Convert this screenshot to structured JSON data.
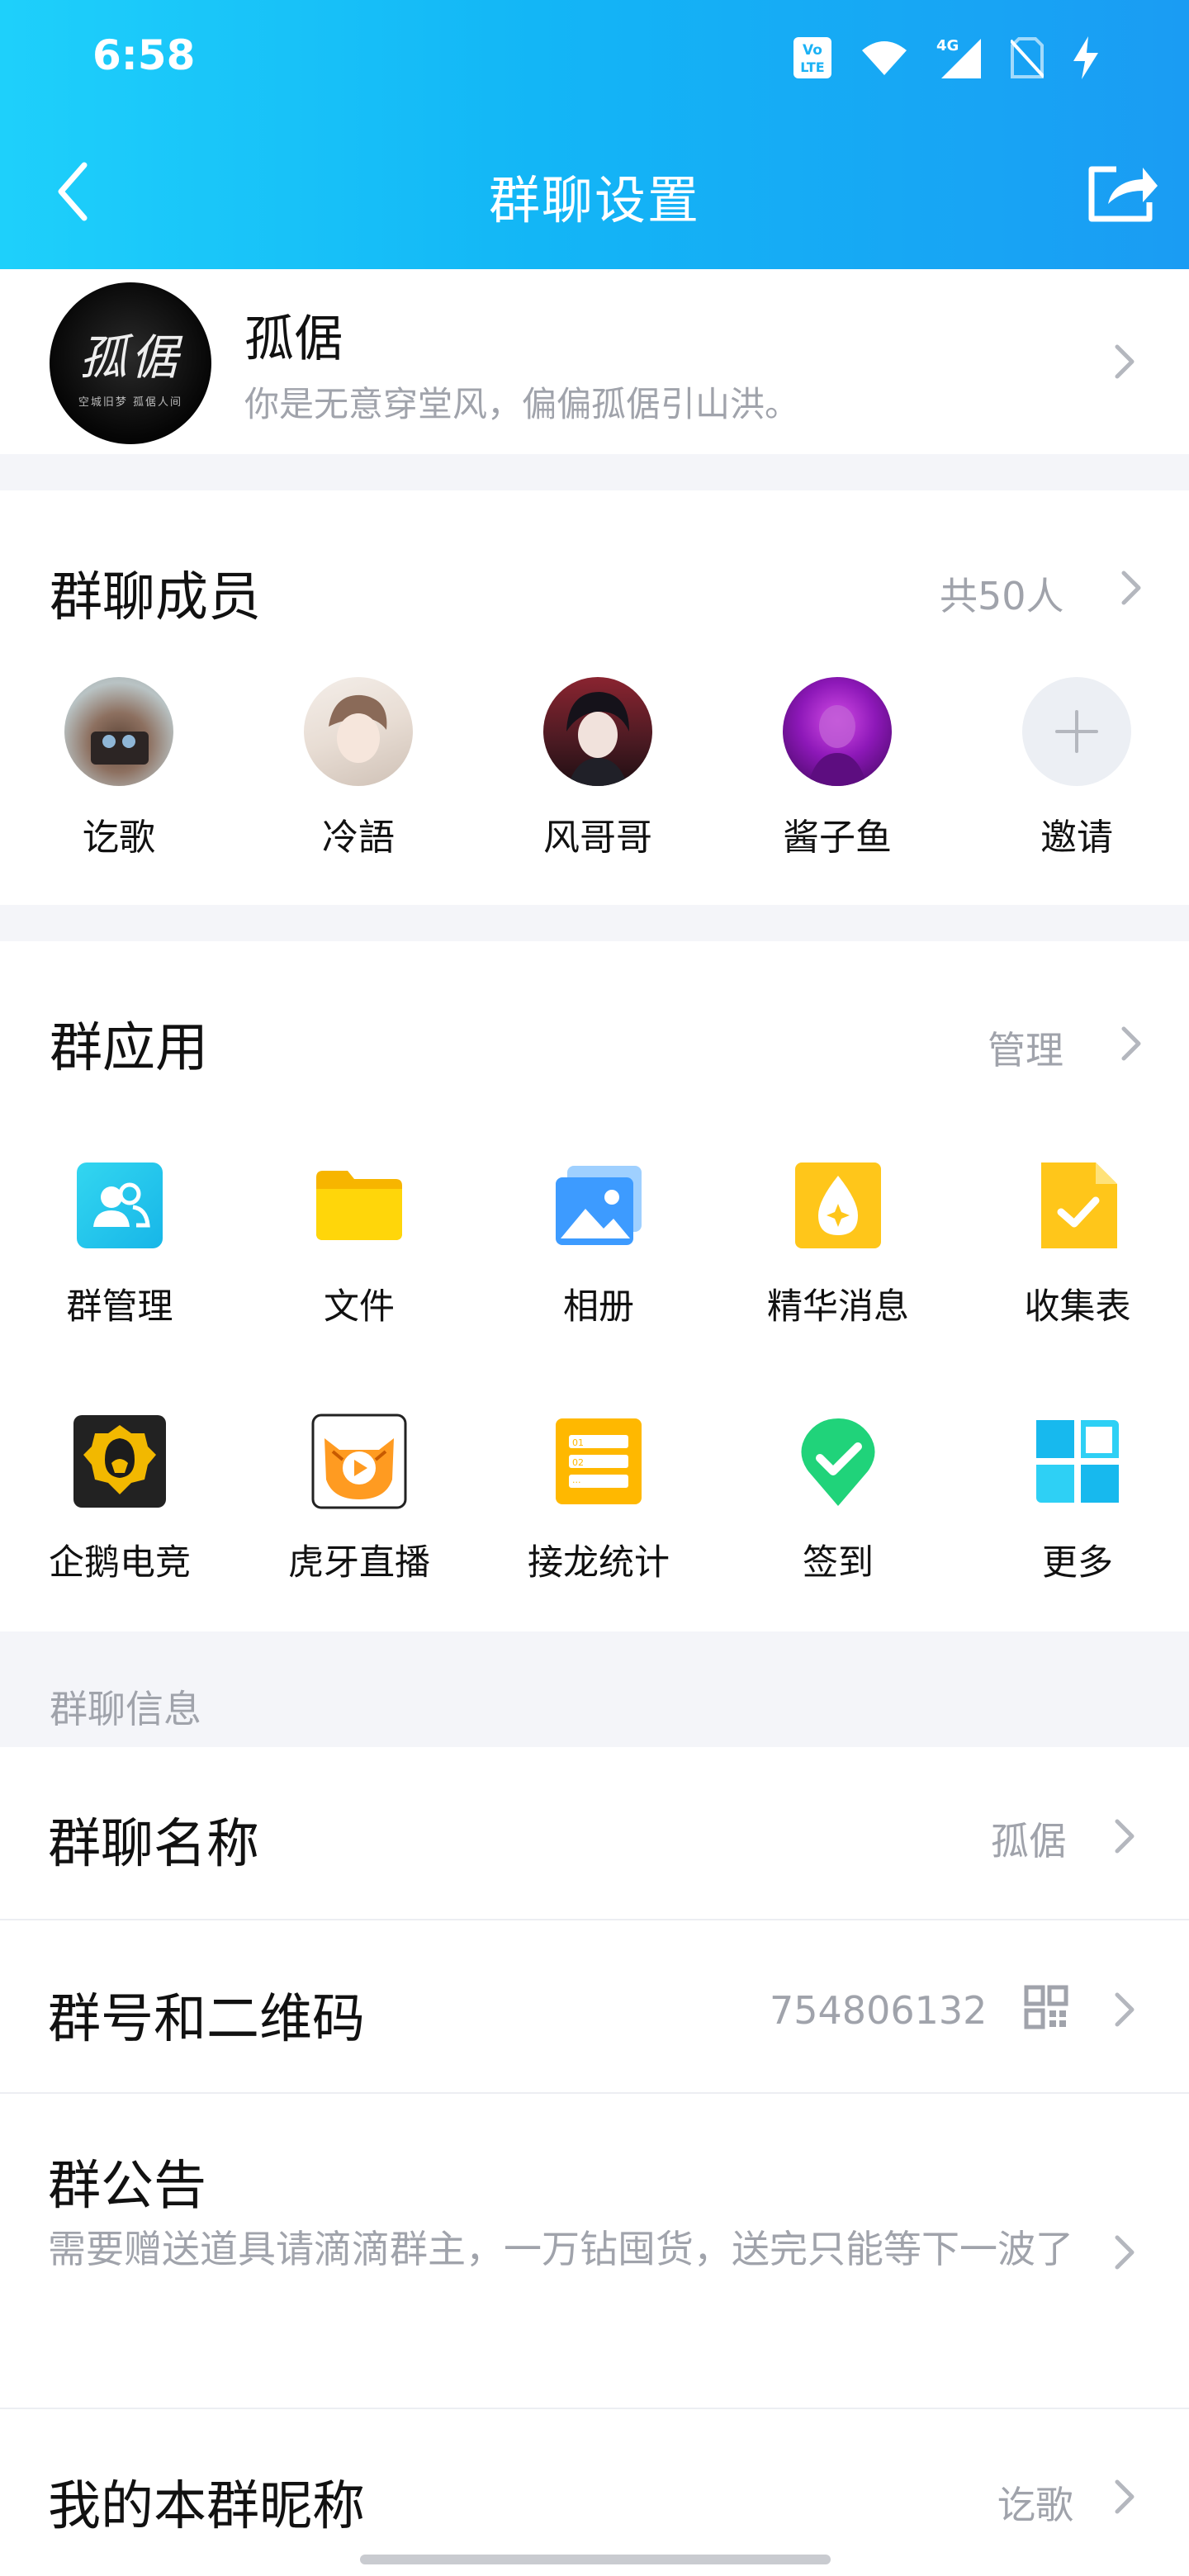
{
  "status_bar": {
    "time": "6:58",
    "volte": "Vo LTE",
    "network": "4G"
  },
  "nav": {
    "title": "群聊设置"
  },
  "group": {
    "name": "孤倨",
    "description": "你是无意穿堂风，偏偏孤倨引山洪。",
    "avatar_text": "孤倨",
    "avatar_subtext": "空城旧梦 孤倨人间"
  },
  "members": {
    "title": "群聊成员",
    "count": "共50人",
    "list": [
      {
        "name": "讫歌"
      },
      {
        "name": "冷語"
      },
      {
        "name": "风哥哥"
      },
      {
        "name": "酱子鱼"
      },
      {
        "name": "邀请"
      }
    ]
  },
  "apps": {
    "title": "群应用",
    "manage": "管理",
    "items": [
      {
        "label": "群管理",
        "icon": "group-manage-icon"
      },
      {
        "label": "文件",
        "icon": "folder-icon"
      },
      {
        "label": "相册",
        "icon": "album-icon"
      },
      {
        "label": "精华消息",
        "icon": "essence-icon"
      },
      {
        "label": "收集表",
        "icon": "form-icon"
      },
      {
        "label": "企鹅电竞",
        "icon": "penguin-esports-icon"
      },
      {
        "label": "虎牙直播",
        "icon": "huya-icon"
      },
      {
        "label": "接龙统计",
        "icon": "solitaire-icon"
      },
      {
        "label": "签到",
        "icon": "checkin-icon"
      },
      {
        "label": "更多",
        "icon": "more-grid-icon"
      }
    ]
  },
  "info": {
    "caption": "群聊信息",
    "group_name_label": "群聊名称",
    "group_name_value": "孤倨",
    "group_id_label": "群号和二维码",
    "group_id_value": "754806132",
    "notice_label": "群公告",
    "notice_text": "需要赠送道具请滴滴群主，一万钻囤货，送完只能等下一波了",
    "nickname_label": "我的本群昵称",
    "nickname_value": "讫歌"
  },
  "colors": {
    "header_start": "#1ed0fb",
    "header_end": "#1a9cf3",
    "secondary_text": "#a0a3ab"
  }
}
